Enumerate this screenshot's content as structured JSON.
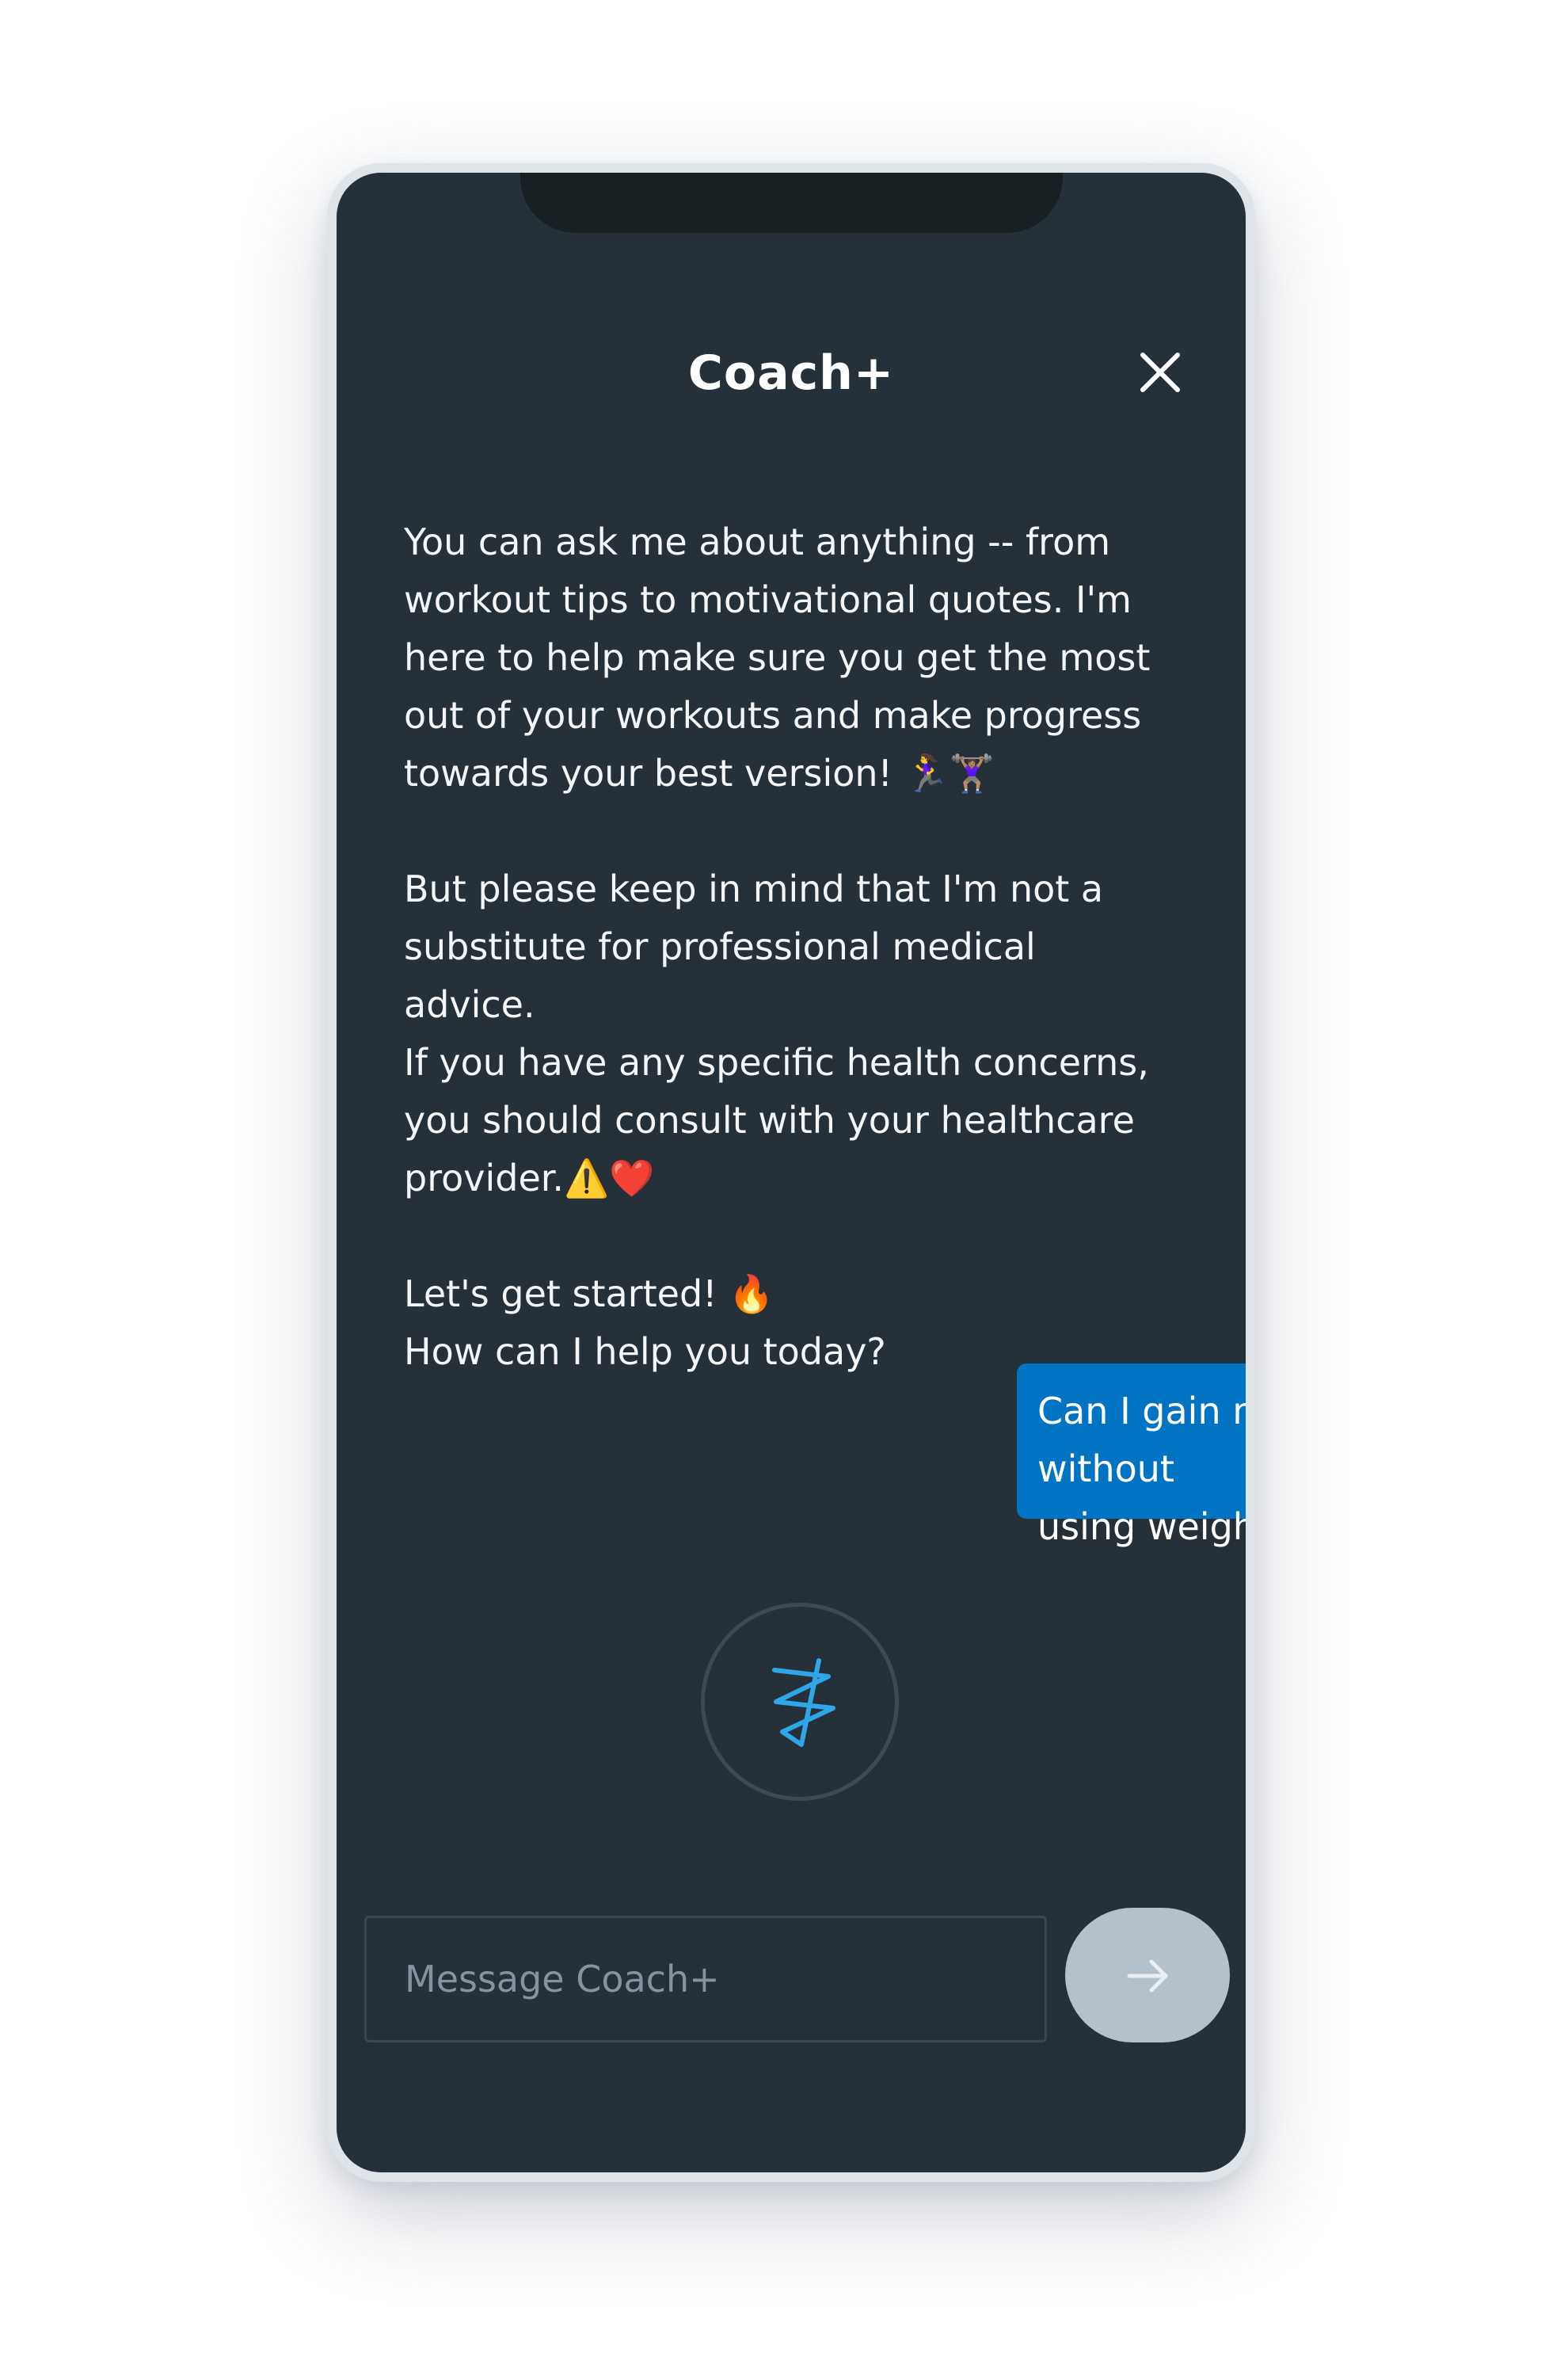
{
  "header": {
    "title": "Coach+"
  },
  "chat": {
    "bot_message": {
      "p1_lines": [
        "You can ask me about anything -- from",
        "workout tips to motivational quotes. I'm",
        "here to help make sure you get the most",
        "out of your workouts and make progress",
        "towards your best version! 🏃‍♀️🏋🏽‍♀️"
      ],
      "p2_lines": [
        "But please keep in mind that I'm not a",
        "substitute for professional medical advice.",
        "If you have any specific health concerns,",
        "you should consult with your healthcare",
        "provider.⚠️❤️"
      ],
      "p3_lines": [
        "Let's get started! 🔥",
        "How can I help you today?"
      ]
    },
    "user_message": {
      "lines": [
        "Can I gain muscle without",
        "using weights?"
      ]
    }
  },
  "composer": {
    "placeholder": "Message Coach+"
  },
  "icons": {
    "close": "close-icon",
    "loading": "loading-squiggle-icon",
    "send": "arrow-right-icon"
  },
  "colors": {
    "screen_bg": "#263038",
    "user_bubble": "#0074c2",
    "send_button": "#b5c1ca",
    "loader_accent": "#2ea6e8"
  }
}
